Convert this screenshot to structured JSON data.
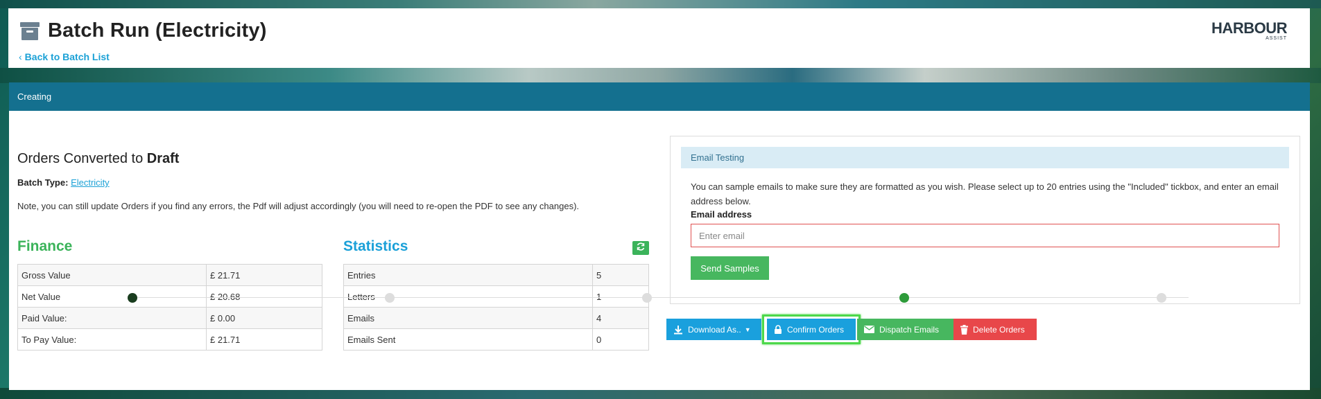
{
  "header": {
    "title": "Batch Run (Electricity)",
    "back_link": "Back to Batch List",
    "logo_main": "HARBOUR",
    "logo_sub": "ASSIST"
  },
  "status": {
    "label": "Creating",
    "bar_color": "#14708f"
  },
  "orders": {
    "heading_prefix": "Orders Converted to ",
    "heading_status": "Draft",
    "batch_type_label": "Batch Type:",
    "batch_type_value": "Electricity",
    "note": "Note, you can still update Orders if you find any errors, the Pdf will adjust accordingly (you will need to re-open the PDF to see any changes)."
  },
  "finance": {
    "title": "Finance",
    "rows": [
      {
        "label": "Gross Value",
        "value": "£ 21.71"
      },
      {
        "label": "Net Value",
        "value": "£ 20.68"
      },
      {
        "label": "Paid Value:",
        "value": "£ 0.00"
      },
      {
        "label": "To Pay Value:",
        "value": "£ 21.71"
      }
    ]
  },
  "statistics": {
    "title": "Statistics",
    "refresh_icon": "refresh-icon",
    "rows": [
      {
        "label": "Entries",
        "value": "5"
      },
      {
        "label": "Letters",
        "value": "1"
      },
      {
        "label": "Emails",
        "value": "4"
      },
      {
        "label": "Emails Sent",
        "value": "0"
      }
    ]
  },
  "email_testing": {
    "title": "Email Testing",
    "description": "You can sample emails to make sure they are formatted as you wish. Please select up to 20 entries using the \"Included\" tickbox, and enter an email address below.",
    "email_label": "Email address",
    "email_placeholder": "Enter email",
    "email_value": "",
    "send_button": "Send Samples"
  },
  "actions": {
    "download": "Download As..",
    "confirm": "Confirm Orders",
    "dispatch": "Dispatch Emails",
    "delete": "Delete Orders"
  },
  "stepper": {
    "steps": [
      {
        "state": "complete",
        "color": "#1a3d1f"
      },
      {
        "state": "pending",
        "color": "#dddddd"
      },
      {
        "state": "pending",
        "color": "#dddddd"
      },
      {
        "state": "active",
        "color": "#2e9b3a"
      },
      {
        "state": "pending",
        "color": "#dddddd"
      }
    ]
  },
  "colors": {
    "finance": "#3bb35a",
    "statistics": "#1aa0d8",
    "primary": "#1aa0dd",
    "success": "#47b75f",
    "danger": "#e8474a",
    "highlight": "#4cd84a"
  }
}
